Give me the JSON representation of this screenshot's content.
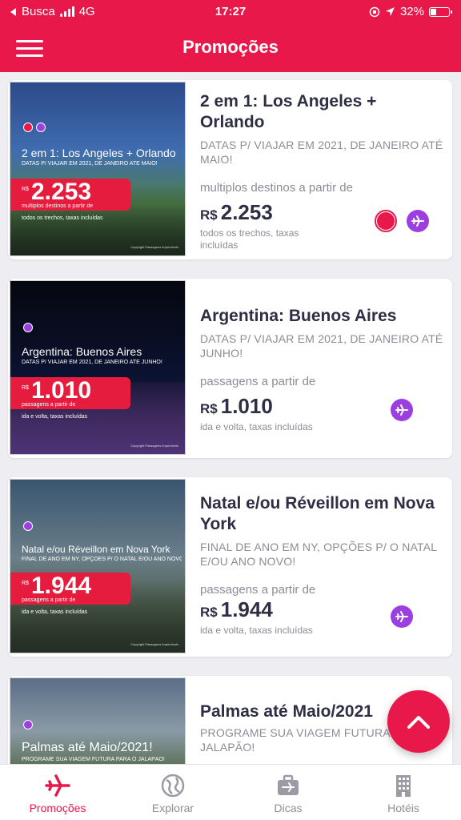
{
  "status_bar": {
    "back_label": "Busca",
    "network": "4G",
    "time": "17:27",
    "battery": "32%"
  },
  "nav": {
    "title": "Promoções",
    "menu_icon": "hamburger-menu-icon"
  },
  "colors": {
    "brand": "#e8184a",
    "purple": "#9c3fe0",
    "text_dark": "#2e2e45",
    "text_muted": "#8c8c96"
  },
  "cards": [
    {
      "title": "2 em 1: Los Angeles + Orlando",
      "subtitle": "DATAS P/ VIAJAR EM 2021, DE JANEIRO ATÉ MAIO!",
      "from_label": "multiplos destinos a partir de",
      "currency": "R$",
      "price": "2.253",
      "price_note": "todos os trechos, taxas incluídas",
      "badges": [
        "multi-destination-icon",
        "plane-icon"
      ],
      "image": {
        "title": "2 em 1: Los Angeles + Orlando",
        "subtitle": "DATAS P/ VIAJAR EM 2021, DE JANEIRO ATÉ MAIO!",
        "currency": "R$",
        "price": "2.253",
        "caption": "multiplos destinos a partir de",
        "note": "todos os trechos, taxas incluídas",
        "copyright": "Copyright Passagens Imperdíveis"
      }
    },
    {
      "title": "Argentina: Buenos Aires",
      "subtitle": "DATAS P/ VIAJAR EM 2021, DE JANEIRO ATÉ JUNHO!",
      "from_label": "passagens a partir de",
      "currency": "R$",
      "price": "1.010",
      "price_note": "ida e volta, taxas incluídas",
      "badges": [
        "plane-icon"
      ],
      "image": {
        "title": "Argentina: Buenos Aires",
        "subtitle": "DATAS P/ VIAJAR EM 2021, DE JANEIRO ATÉ JUNHO!",
        "currency": "R$",
        "price": "1.010",
        "caption": "passagens a partir de",
        "note": "ida e volta, taxas incluídas",
        "copyright": "Copyright Passagens Imperdíveis"
      }
    },
    {
      "title": "Natal e/ou Réveillon em Nova York",
      "subtitle": "FINAL DE ANO EM NY, OPÇÕES P/ O NATAL E/OU ANO NOVO!",
      "from_label": "passagens a partir de",
      "currency": "R$",
      "price": "1.944",
      "price_note": "ida e volta, taxas incluídas",
      "badges": [
        "plane-icon"
      ],
      "image": {
        "title": "Natal e/ou Réveillon em Nova York",
        "subtitle": "FINAL DE ANO EM NY, OPÇÕES P/ O NATAL E/OU ANO NOVO!",
        "currency": "R$",
        "price": "1.944",
        "caption": "passagens a partir de",
        "note": "ida e volta, taxas incluídas",
        "copyright": "Copyright Passagens Imperdíveis"
      }
    },
    {
      "title": "Palmas até Maio/2021",
      "subtitle": "PROGRAME SUA VIAGEM FUTURA PARA O JALAPÃO!",
      "image": {
        "title": "Palmas até Maio/2021!",
        "subtitle": "PROGRAME SUA VIAGEM FUTURA PARA O JALAPÃO!"
      }
    }
  ],
  "fab": {
    "icon": "chevron-up-icon"
  },
  "tabs": [
    {
      "label": "Promoções",
      "icon": "plane-icon",
      "active": true
    },
    {
      "label": "Explorar",
      "icon": "globe-icon",
      "active": false
    },
    {
      "label": "Dicas",
      "icon": "suitcase-icon",
      "active": false
    },
    {
      "label": "Hotéis",
      "icon": "building-icon",
      "active": false
    }
  ]
}
